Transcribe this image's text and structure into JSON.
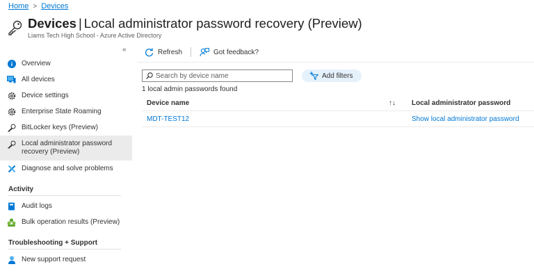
{
  "breadcrumb": {
    "home": "Home",
    "separator": ">",
    "current": "Devices"
  },
  "header": {
    "title_bold": "Devices",
    "title_sep": "|",
    "title_rest": "Local administrator password recovery (Preview)",
    "subtitle": "Liams Tech High School - Azure Active Directory",
    "more": "···"
  },
  "sidebar": {
    "collapse": "«",
    "items": [
      {
        "label": "Overview",
        "icon": "info-icon"
      },
      {
        "label": "All devices",
        "icon": "devices-icon"
      },
      {
        "label": "Device settings",
        "icon": "gear-icon"
      },
      {
        "label": "Enterprise State Roaming",
        "icon": "gear-icon"
      },
      {
        "label": "BitLocker keys (Preview)",
        "icon": "key-icon"
      },
      {
        "label": "Local administrator password recovery (Preview)",
        "icon": "key-icon"
      },
      {
        "label": "Diagnose and solve problems",
        "icon": "wrench-icon"
      }
    ],
    "activity_header": "Activity",
    "activity_items": [
      {
        "label": "Audit logs",
        "icon": "book-icon"
      },
      {
        "label": "Bulk operation results (Preview)",
        "icon": "people-icon"
      }
    ],
    "support_header": "Troubleshooting + Support",
    "support_items": [
      {
        "label": "New support request",
        "icon": "support-person-icon"
      }
    ]
  },
  "toolbar": {
    "refresh_label": "Refresh",
    "feedback_label": "Got feedback?"
  },
  "search": {
    "placeholder": "Search by device name",
    "value": ""
  },
  "filters": {
    "add_label": "Add filters"
  },
  "results": {
    "count_text": "1 local admin passwords found"
  },
  "table": {
    "columns": [
      "Device name",
      "Local administrator password"
    ],
    "sort_glyph": "↑↓",
    "rows": [
      {
        "device": "MDT-TEST12",
        "action": "Show local administrator password"
      }
    ]
  },
  "colors": {
    "accent": "#0078d4",
    "active_bg": "#ebebeb",
    "filter_bg": "#e5f1fb"
  }
}
